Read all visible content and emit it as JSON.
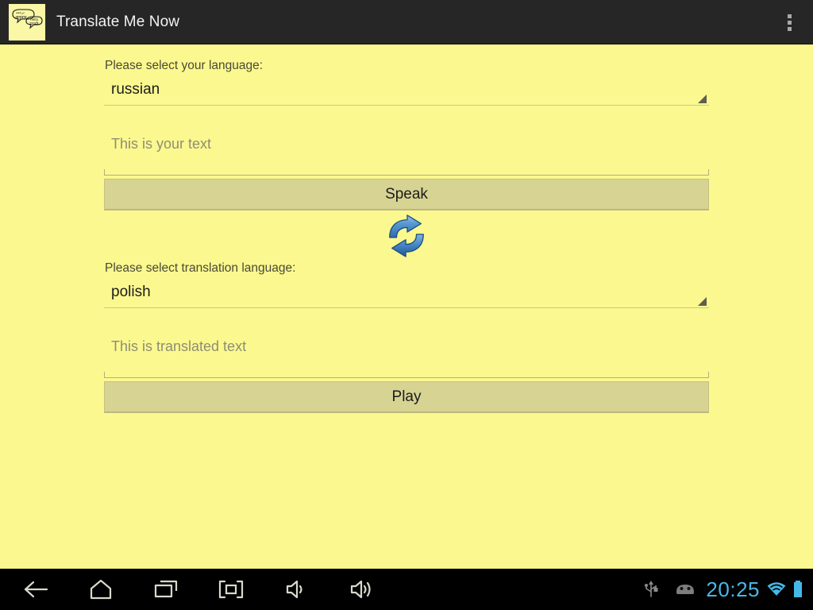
{
  "app": {
    "title": "Translate Me Now",
    "icon_name": "speech-bubbles-app-icon",
    "background_color": "#fbf88f",
    "action_bar_color": "#262626",
    "button_color": "#d7d393",
    "accent_color": "#46b8e8"
  },
  "action_bar": {
    "overflow_label": "more-options"
  },
  "source": {
    "label": "Please select your language:",
    "selected_language": "russian",
    "text_placeholder": "This is your text",
    "text_value": "",
    "speak_button": "Speak"
  },
  "swap": {
    "icon_name": "swap-languages-icon"
  },
  "target": {
    "label": "Please select translation language:",
    "selected_language": "polish",
    "text_placeholder": "This is translated text",
    "text_value": "",
    "play_button": "Play"
  },
  "nav_bar": {
    "buttons": [
      {
        "name": "back",
        "label": "Back"
      },
      {
        "name": "home",
        "label": "Home"
      },
      {
        "name": "recents",
        "label": "Recent apps"
      },
      {
        "name": "screenshot",
        "label": "Screenshot"
      },
      {
        "name": "volume-down",
        "label": "Volume down"
      },
      {
        "name": "volume-up",
        "label": "Volume up"
      }
    ],
    "status": {
      "usb": "usb-icon",
      "adb": "android-debug-icon",
      "clock": "20:25",
      "wifi": "wifi-icon",
      "battery": "battery-full-icon"
    }
  }
}
